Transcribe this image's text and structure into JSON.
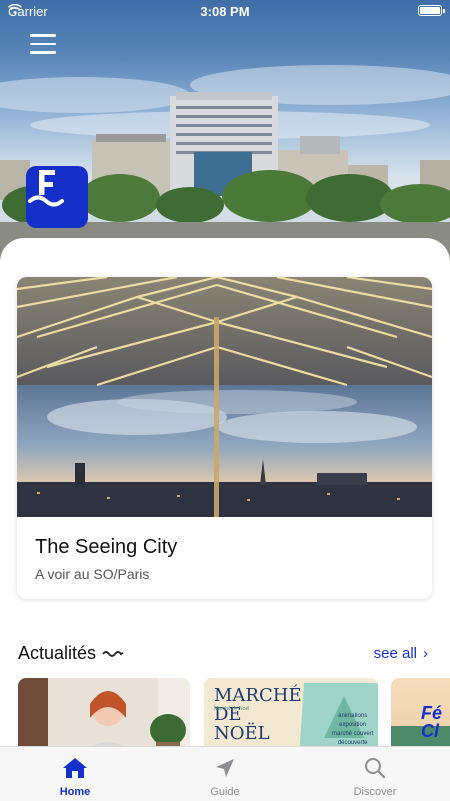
{
  "status_bar": {
    "carrier": "Carrier",
    "time": "3:08 PM"
  },
  "colors": {
    "brand": "#1530c8",
    "tab_inactive": "#8e8e93"
  },
  "icons": {
    "menu": "hamburger-icon",
    "logo": "f-wave-logo",
    "home": "home-icon",
    "guide": "navigation-arrow-icon",
    "discover": "search-icon"
  },
  "featured": {
    "title": "The Seeing City",
    "subtitle": "A voir au SO/Paris"
  },
  "news": {
    "title": "Actualités",
    "see_all": "see all",
    "cards": [
      {
        "text": ""
      },
      {
        "line1": "MARCHÉ",
        "line2": "DE",
        "line3": "NOËL",
        "extra1": "animations",
        "extra2": "exposition",
        "extra3": "marché couvert",
        "extra4": "découverte",
        "extra5": "Marché de Noël"
      },
      {
        "text": "Fé Cl"
      }
    ]
  },
  "tabs": [
    {
      "label": "Home",
      "active": true
    },
    {
      "label": "Guide",
      "active": false
    },
    {
      "label": "Discover",
      "active": false
    }
  ]
}
